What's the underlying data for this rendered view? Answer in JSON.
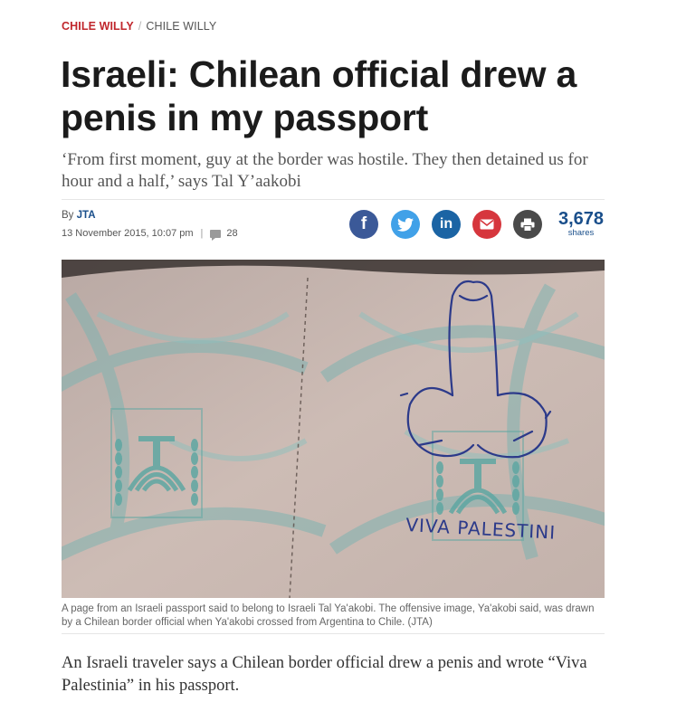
{
  "breadcrumb": {
    "section": "CHILE WILLY",
    "separator": "/",
    "subsection": "CHILE WILLY"
  },
  "article": {
    "headline": "Israeli: Chilean official drew a penis in my passport",
    "subheadline": "‘From first moment, guy at the border was hostile. They then detained us for hour and a half,’ says Tal Y’aakobi",
    "byline_prefix": "By",
    "author": "JTA",
    "date": "13 November 2015, 10:07 pm",
    "meta_separator": "|",
    "comments_count": "28",
    "image_handwriting": "VIVA PALESTINI",
    "caption": "A page from an Israeli passport said to belong to Israeli Tal Ya'akobi. The offensive image, Ya'akobi said, was drawn by a Chilean border official when Ya'akobi crossed from Argentina to Chile. (JTA)",
    "lead": "An Israeli traveler says a Chilean border official drew a penis and wrote “Viva Palestinia” in his passport."
  },
  "share": {
    "buttons": [
      {
        "name": "facebook-icon",
        "glyph": "f",
        "color": "#3b5998"
      },
      {
        "name": "twitter-icon",
        "glyph": "",
        "color": "#41a1e8"
      },
      {
        "name": "linkedin-icon",
        "glyph": "in",
        "color": "#1b64a4"
      },
      {
        "name": "email-icon",
        "glyph": "",
        "color": "#d6363d"
      },
      {
        "name": "print-icon",
        "glyph": "",
        "color": "#4a4a4a"
      }
    ],
    "count": "3,678",
    "count_label": "shares"
  },
  "colors": {
    "section_red": "#c0262c",
    "link_blue": "#1a4f8b"
  }
}
